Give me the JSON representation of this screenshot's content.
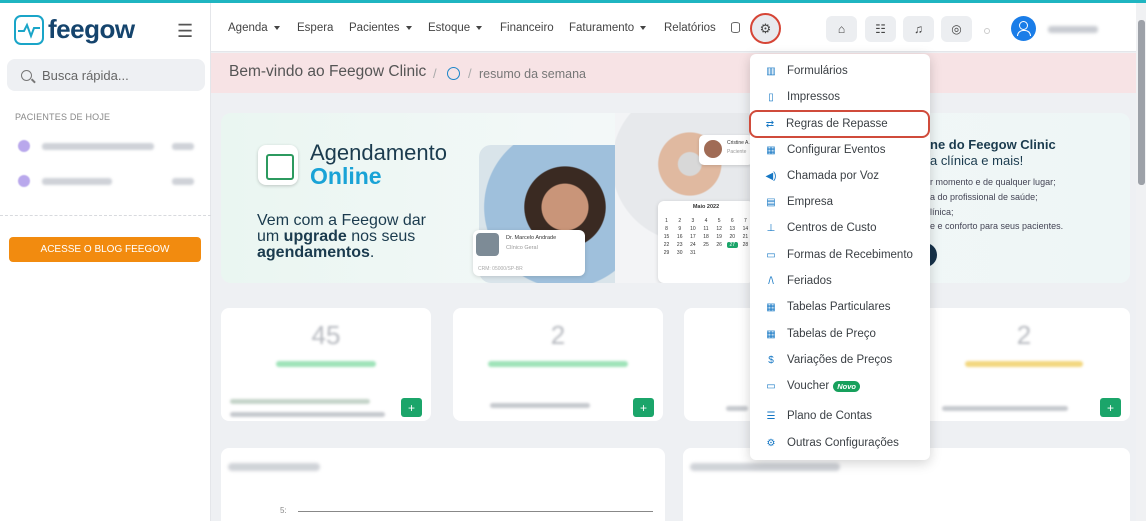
{
  "app": {
    "name": "feegow",
    "colors": {
      "accent": "#1aa5c8",
      "orange": "#f28b0f",
      "highlight_red": "#d04b3b",
      "menu_icon": "#1577c4",
      "green": "#1ba56a"
    }
  },
  "sidebar": {
    "search_placeholder": "Busca rápida...",
    "section_title": "PACIENTES DE HOJE",
    "blog_button": "ACESSE O BLOG FEEGOW"
  },
  "topnav": {
    "items": [
      {
        "label": "Agenda",
        "dropdown": true
      },
      {
        "label": "Espera",
        "dropdown": false
      },
      {
        "label": "Pacientes",
        "dropdown": true
      },
      {
        "label": "Estoque",
        "dropdown": true
      },
      {
        "label": "Financeiro",
        "dropdown": false
      },
      {
        "label": "Faturamento",
        "dropdown": true
      },
      {
        "label": "Relatórios",
        "dropdown": false
      }
    ],
    "icons": [
      "database-icon",
      "gear-icon",
      "inbox-icon",
      "checklist-icon",
      "bell-icon",
      "chat-icon",
      "user-avatar-icon"
    ]
  },
  "breadcrumb": {
    "title": "Bem-vindo ao Feegow Clinic",
    "separator": "/",
    "sub": "resumo da semana"
  },
  "banner": {
    "title_line1": "Agendamento",
    "title_line2": "Online",
    "text_part1": "Vem com a Feegow dar",
    "text_part2": "um ",
    "text_bold1": "upgrade",
    "text_part3": " nos seus",
    "text_bold2": "agendamentos",
    "text_end": ".",
    "doctor_name": "Dr. Marcelo Andrade",
    "doctor_role": "Clínico Geral",
    "doctor_crm": "CRM: 05000/SP-BR",
    "card_name": "Cristine A.",
    "card_role": "Paciente",
    "calendar_month": "Maio 2022",
    "calendar_days": [
      "1",
      "2",
      "3",
      "4",
      "5",
      "6",
      "7",
      "8",
      "9",
      "10",
      "11",
      "12",
      "13",
      "14",
      "15",
      "16",
      "17",
      "18",
      "19",
      "20",
      "21",
      "22",
      "23",
      "24",
      "25",
      "26",
      "27",
      "28",
      "29",
      "30",
      "31"
    ],
    "right_title_pre": "ne do ",
    "right_title_bold": "Feegow Clinic",
    "right_sub": "a clínica e mais!",
    "right_lines": [
      "r momento e de qualquer lugar;",
      "a do profissional de saúde;",
      "línica;",
      "e e conforto para seus pacientes."
    ]
  },
  "stats": [
    {
      "value": "45"
    },
    {
      "value": "2"
    },
    {
      "value": ""
    },
    {
      "value": "2"
    }
  ],
  "settings_menu": {
    "items": [
      {
        "label": "Formulários",
        "icon": "chart-icon",
        "glyph": "▥"
      },
      {
        "label": "Impressos",
        "icon": "file-icon",
        "glyph": "▯"
      },
      {
        "label": "Regras de Repasse",
        "icon": "transfer-icon",
        "glyph": "⇄"
      },
      {
        "label": "Configurar Eventos",
        "icon": "calendar-icon",
        "glyph": "▦"
      },
      {
        "label": "Chamada por Voz",
        "icon": "volume-icon",
        "glyph": "◀)"
      },
      {
        "label": "Empresa",
        "icon": "building-icon",
        "glyph": "▤"
      },
      {
        "label": "Centros de Custo",
        "icon": "sitemap-icon",
        "glyph": "⊥"
      },
      {
        "label": "Formas de Recebimento",
        "icon": "credit-card-icon",
        "glyph": "▭"
      },
      {
        "label": "Feriados",
        "icon": "road-icon",
        "glyph": "/\\"
      },
      {
        "label": "Tabelas Particulares",
        "icon": "table-icon",
        "glyph": "▦"
      },
      {
        "label": "Tabelas de Preço",
        "icon": "table-icon",
        "glyph": "▦"
      },
      {
        "label": "Variações de Preços",
        "icon": "dollar-icon",
        "glyph": "$"
      },
      {
        "label": "Voucher",
        "icon": "ticket-icon",
        "glyph": "▭",
        "badge": "Novo"
      },
      {
        "label": "Plano de Contas",
        "icon": "list-icon",
        "glyph": "☰"
      },
      {
        "label": "Outras Configurações",
        "icon": "cogs-icon",
        "glyph": "⚙"
      }
    ],
    "highlighted_index": 2
  },
  "chart_panel": {
    "axis_tick": "5"
  }
}
